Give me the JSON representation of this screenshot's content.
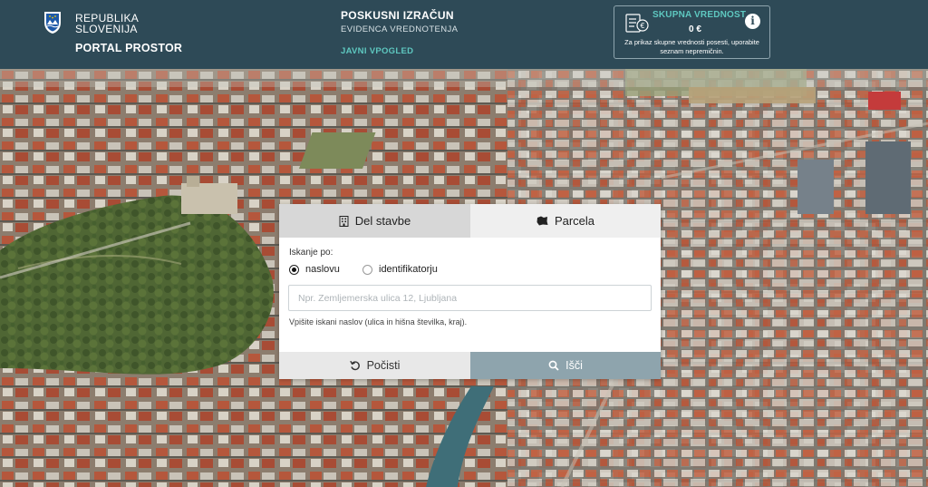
{
  "header": {
    "brand_line1": "REPUBLIKA",
    "brand_line2": "SLOVENIJA",
    "portal": "PORTAL PROSTOR",
    "title": "POSKUSNI IZRAČUN",
    "subtitle": "EVIDENCA VREDNOTENJA",
    "view_mode": "JAVNI VPOGLED",
    "total_value_title": "SKUPNA VREDNOST",
    "total_value_amount": "0 €",
    "total_value_note": "Za prikaz skupne vrednosti posesti, uporabite seznam nepremičnin.",
    "info_icon": "info-icon",
    "ledger_icon": "property-list-icon",
    "coat_icon": "coat-of-arms-icon"
  },
  "search": {
    "tabs": [
      {
        "label": "Del stavbe",
        "icon": "building-icon",
        "active": true
      },
      {
        "label": "Parcela",
        "icon": "parcel-icon",
        "active": false
      }
    ],
    "search_by_label": "Iskanje po:",
    "options": [
      {
        "label": "naslovu",
        "selected": true
      },
      {
        "label": "identifikatorju",
        "selected": false
      }
    ],
    "input_placeholder": "Npr. Zemljemerska ulica 12, Ljubljana",
    "input_value": "",
    "hint": "Vpišite iskani naslov (ulica in hišna številka, kraj).",
    "clear_label": "Počisti",
    "search_label": "Išči"
  },
  "colors": {
    "header_bg": "#2e4a57",
    "accent": "#5ec8c0",
    "search_button": "#8ea4ad"
  }
}
